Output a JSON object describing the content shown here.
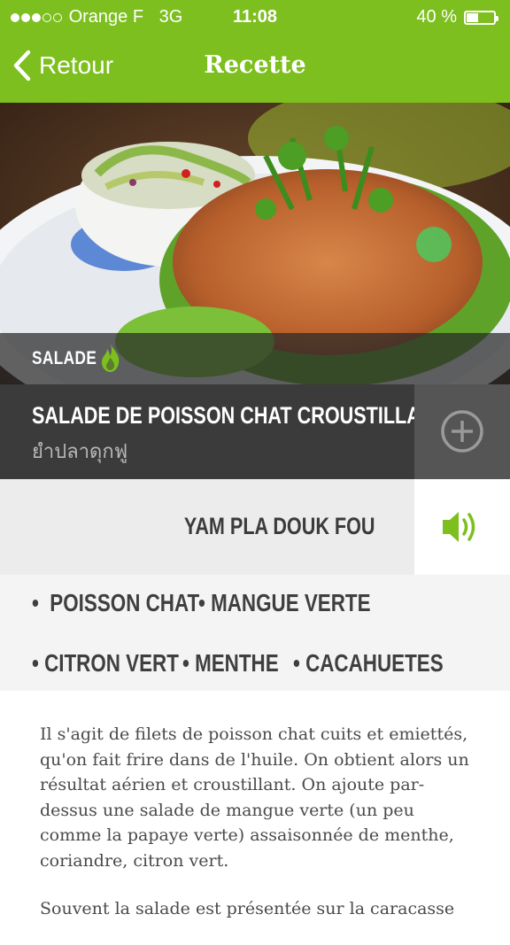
{
  "status_bar": {
    "carrier": "Orange F",
    "network": "3G",
    "time": "11:08",
    "battery": "40 %",
    "battery_level": 0.4
  },
  "nav": {
    "back_label": "Retour",
    "title": "Recette"
  },
  "recipe": {
    "category": "SALADE",
    "name": "SALADE DE POISSON CHAT CROUSTILLANT",
    "name_thai": "ยำปลาดุกฟู",
    "pronunciation": "YAM PLA DOUK FOU",
    "ingredients_row1": [
      "POISSON CHAT",
      "MANGUE VERTE"
    ],
    "ingredients_row2": [
      "CITRON VERT",
      "MENTHE",
      "CACAHUETES"
    ],
    "description_1": "Il s'agit de filets de poisson chat cuits et emiettés, qu'on fait frire dans de l'huile. On obtient alors un résultat aérien et croustillant. On ajoute par-dessus une salade de mangue verte (un peu comme la papaye verte) assaisonnée de menthe, coriandre, citron vert.",
    "description_2": "Souvent la salade est présentée sur la caracasse"
  },
  "colors": {
    "accent": "#7cbf1e",
    "dark_bar": "#3b3b3b",
    "add_box": "#555555"
  },
  "icons": {
    "back": "chevron-left-icon",
    "spicy": "flame-icon",
    "add": "plus-circle-icon",
    "audio": "speaker-icon"
  }
}
